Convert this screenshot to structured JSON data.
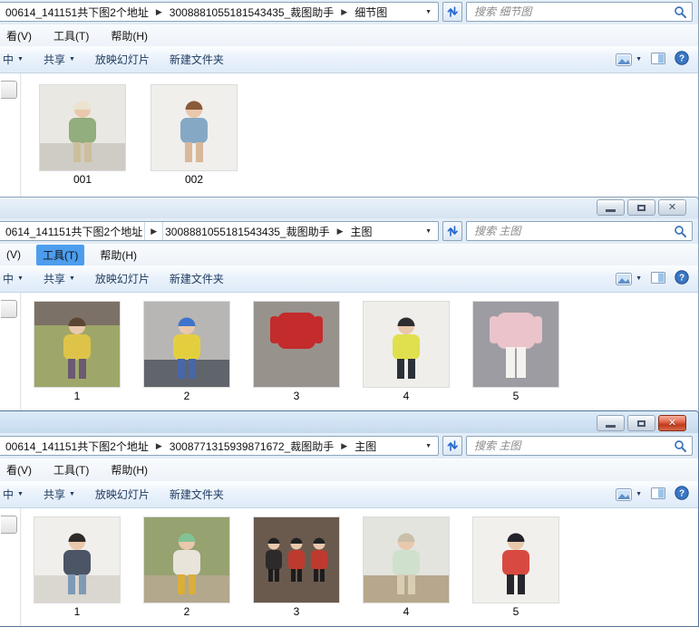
{
  "colors": {
    "chrome_blue": "#d6e2f0",
    "close_button_red": "#c13a1c",
    "menu_highlight_blue": "#4d9dee",
    "toolbar_text": "#1e3a5f",
    "search_placeholder_gray": "#8a8a8a",
    "refresh_icon_blue": "#2566c9"
  },
  "windows": [
    {
      "address": {
        "seg1": "00614_141151共下图2个地址",
        "seg2": "3008881055181543435_裁图助手",
        "seg3": "细节图"
      },
      "search": {
        "placeholder": "搜索 细节图"
      },
      "menu": {
        "items": [
          "看(V)",
          "工具(T)",
          "帮助(H)"
        ]
      },
      "toolbar": {
        "include_tail": "中",
        "share": "共享",
        "slideshow": "放映幻灯片",
        "new_folder": "新建文件夹"
      },
      "items": [
        {
          "label": "001",
          "kind": "person",
          "bg": "#eae8e3",
          "floor": "#cfccc5",
          "hair": "#ece3cf",
          "top": "#92ad7e",
          "bottom": "#cdbf9d"
        },
        {
          "label": "002",
          "kind": "person",
          "bg": "#f0efec",
          "hair": "#8a5a3a",
          "top": "#85a9c5",
          "bottom": "#d9b89a"
        }
      ]
    },
    {
      "address": {
        "seg1": "0614_141151共下图2个地址",
        "seg2": "3008881055181543435_裁图助手",
        "seg3": "主图"
      },
      "search": {
        "placeholder": "搜索 主图"
      },
      "menu": {
        "items": [
          "(V)",
          "工具(T)",
          "帮助(H)"
        ]
      },
      "toolbar": {
        "include_tail": "中",
        "share": "共享",
        "slideshow": "放映幻灯片",
        "new_folder": "新建文件夹"
      },
      "items": [
        {
          "label": "1",
          "kind": "person",
          "band": "#7b7166",
          "bg": "#9ea769",
          "hair": "#5a4632",
          "top": "#ddc449",
          "bottom": "#6a5a72"
        },
        {
          "label": "2",
          "kind": "person",
          "bg": "#b7b6b4",
          "floor": "#60646b",
          "hair": "#3f74cc",
          "top": "#e3cf3e",
          "bottom": "#4767a8"
        },
        {
          "label": "3",
          "kind": "flat",
          "bg": "#97928c",
          "top": "#c32b2c"
        },
        {
          "label": "4",
          "kind": "person",
          "bg": "#efeeea",
          "hair": "#2e2e30",
          "top": "#e0e04e",
          "bottom": "#2c3138"
        },
        {
          "label": "5",
          "kind": "flat",
          "bg": "#9c9ca2",
          "top": "#eac4ca",
          "bottom": "#f4f2ee"
        }
      ]
    },
    {
      "address": {
        "seg1": "00614_141151共下图2个地址",
        "seg2": "3008771315939871672_裁图助手",
        "seg3": "主图"
      },
      "search": {
        "placeholder": "搜索 主图"
      },
      "menu": {
        "items": [
          "看(V)",
          "工具(T)",
          "帮助(H)"
        ]
      },
      "toolbar": {
        "include_tail": "中",
        "share": "共享",
        "slideshow": "放映幻灯片",
        "new_folder": "新建文件夹"
      },
      "items": [
        {
          "label": "1",
          "kind": "person",
          "bg": "#f1efeb",
          "floor": "#dad6d0",
          "hair": "#2f2a28",
          "top": "#4c5565",
          "bottom": "#7e9ab5"
        },
        {
          "label": "2",
          "kind": "person",
          "bg": "#97a271",
          "floor": "#b3a78c",
          "hair": "#82c295",
          "top": "#e8e4da",
          "bottom": "#d9ae3a"
        },
        {
          "label": "3",
          "kind": "group",
          "bg": "#6a5a4e",
          "hair": "#222222",
          "top": "#bf3a2e",
          "bottom": "#2d2a2b"
        },
        {
          "label": "4",
          "kind": "person",
          "bg": "#e3e4de",
          "floor": "#b7a78c",
          "hair": "#cabfa8",
          "top": "#cfe0cd",
          "bottom": "#d9cdb4"
        },
        {
          "label": "5",
          "kind": "person",
          "bg": "#f2f0ec",
          "hair": "#23232a",
          "top": "#d84a41",
          "bottom": "#26262c"
        }
      ]
    }
  ]
}
